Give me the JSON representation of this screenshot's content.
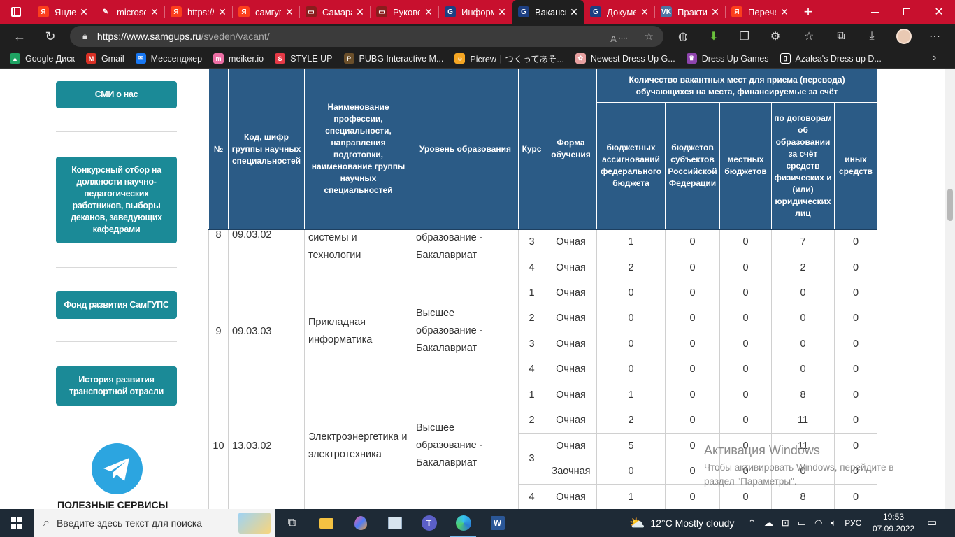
{
  "browser": {
    "tabs": [
      {
        "title": "Яндекс",
        "fav": "Я",
        "color": "#fc3f1d"
      },
      {
        "title": "microsoft",
        "fav": "✎",
        "color": "#c8102e"
      },
      {
        "title": "https://",
        "fav": "Я",
        "color": "#fc3f1d"
      },
      {
        "title": "самгупс",
        "fav": "Я",
        "color": "#fc3f1d"
      },
      {
        "title": "Самара",
        "fav": "▭",
        "color": "#8a1d1d"
      },
      {
        "title": "Руководство",
        "fav": "▭",
        "color": "#8a1d1d"
      },
      {
        "title": "Информация",
        "fav": "G",
        "color": "#1d3f82"
      },
      {
        "title": "Вакансии",
        "fav": "G",
        "color": "#1d3f82"
      },
      {
        "title": "Документы",
        "fav": "G",
        "color": "#1d3f82"
      },
      {
        "title": "Практика",
        "fav": "VK",
        "color": "#4c75a3"
      },
      {
        "title": "Перечень",
        "fav": "Я",
        "color": "#fc3f1d"
      }
    ],
    "active_tab_index": 7,
    "url_host": "https://www.samgups.ru",
    "url_path": "/sveden/vacant/",
    "bookmarks": [
      {
        "label": "Google Диск",
        "color": "#1fa463",
        "icon": "▲"
      },
      {
        "label": "Gmail",
        "color": "#d93025",
        "icon": "M"
      },
      {
        "label": "Мессенджер",
        "color": "#1877f2",
        "icon": "✉"
      },
      {
        "label": "meiker.io",
        "color": "#ec6fa5",
        "icon": "m"
      },
      {
        "label": "STYLE UP",
        "color": "#e63946",
        "icon": "S"
      },
      {
        "label": "PUBG Interactive M...",
        "color": "#6b4f2a",
        "icon": "P"
      },
      {
        "label": "Picrew｜つくってあそ...",
        "color": "#f5a623",
        "icon": "☺"
      },
      {
        "label": "Newest Dress Up G...",
        "color": "#e8a0a0",
        "icon": "✿"
      },
      {
        "label": "Dress Up Games",
        "color": "#8e44ad",
        "icon": "♛"
      },
      {
        "label": "Azalea's Dress up D...",
        "color": "#ffffff",
        "icon": "▯"
      }
    ]
  },
  "sidebar": {
    "items": [
      {
        "label": "СМИ о нас"
      },
      {
        "label": "Конкурсный отбор на должности научно-педагогических работников, выборы деканов, заведующих кафедрами"
      },
      {
        "label": "Фонд развития СамГУПС"
      },
      {
        "label": "История развития транспортной отрасли"
      }
    ],
    "services_title": "ПОЛЕЗНЫЕ СЕРВИСЫ"
  },
  "table": {
    "header": {
      "no": "№",
      "code": "Код, шифр группы научных специальностей",
      "name": "Наименование профессии, специальности, направления подготовки, наименование группы научных специальностей",
      "level": "Уровень образования",
      "course": "Курс",
      "form": "Форма обучения",
      "group": "Количество вакантных мест для приема (перевода) обучающихся на места, финансируемые за счёт",
      "federal": "бюджетных ассигнований федерального бюджета",
      "subjects": "бюджетов субъектов Российской Федерации",
      "local": "местных бюджетов",
      "contracts": "по договорам об образовании за счёт средств физических и (или) юридических лиц",
      "other": "иных средств"
    },
    "partial": {
      "no": "8",
      "code": "09.03.02",
      "name_line1": "системы и",
      "name_line2": "технологии",
      "level_line1": "образование -",
      "level_line2": "Бакалавриат",
      "rows": [
        {
          "course": "3",
          "form": "Очная",
          "v": [
            "1",
            "0",
            "0",
            "7",
            "0"
          ]
        },
        {
          "course": "4",
          "form": "Очная",
          "v": [
            "2",
            "0",
            "0",
            "2",
            "0"
          ]
        }
      ]
    },
    "groups": [
      {
        "no": "9",
        "code": "09.03.03",
        "name": "Прикладная информатика",
        "level": "Высшее образование - Бакалавриат",
        "rows": [
          {
            "course": "1",
            "form": "Очная",
            "v": [
              "0",
              "0",
              "0",
              "0",
              "0"
            ]
          },
          {
            "course": "2",
            "form": "Очная",
            "v": [
              "0",
              "0",
              "0",
              "0",
              "0"
            ]
          },
          {
            "course": "3",
            "form": "Очная",
            "v": [
              "0",
              "0",
              "0",
              "0",
              "0"
            ]
          },
          {
            "course": "4",
            "form": "Очная",
            "v": [
              "0",
              "0",
              "0",
              "0",
              "0"
            ]
          }
        ]
      },
      {
        "no": "10",
        "code": "13.03.02",
        "name": "Электроэнергетика и электротехника",
        "level": "Высшее образование - Бакалавриат",
        "rows": [
          {
            "course": "1",
            "form": "Очная",
            "v": [
              "1",
              "0",
              "0",
              "8",
              "0"
            ]
          },
          {
            "course": "2",
            "form": "Очная",
            "v": [
              "2",
              "0",
              "0",
              "11",
              "0"
            ]
          },
          {
            "course": "3",
            "form": "Очная",
            "v": [
              "5",
              "0",
              "0",
              "11",
              "0"
            ]
          },
          {
            "course": "",
            "form": "Заочная",
            "v": [
              "0",
              "0",
              "0",
              "0",
              "0"
            ]
          },
          {
            "course": "4",
            "form": "Очная",
            "v": [
              "1",
              "0",
              "0",
              "8",
              "0"
            ]
          }
        ]
      }
    ]
  },
  "watermark": {
    "title": "Активация Windows",
    "line1": "Чтобы активировать Windows, перейдите в",
    "line2": "раздел \"Параметры\"."
  },
  "taskbar": {
    "search_placeholder": "Введите здесь текст для поиска",
    "weather": "12°C  Mostly cloudy",
    "lang": "РУС",
    "time": "19:53",
    "date": "07.09.2022"
  }
}
